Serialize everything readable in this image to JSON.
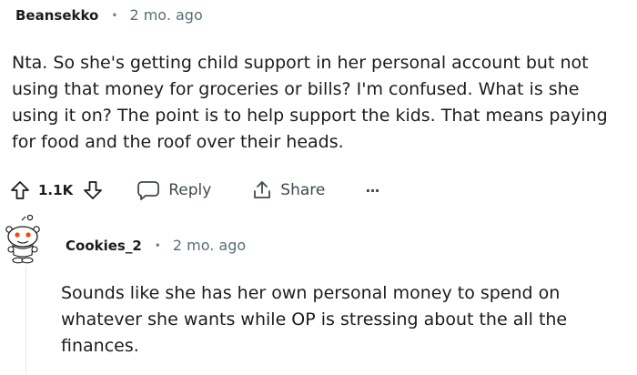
{
  "comment1": {
    "author": "Beansekko",
    "separator": "•",
    "time": "2 mo. ago",
    "lines": [
      "Nta. So she's getting child support in her personal account but not",
      "using that money for groceries or bills? I'm confused. What is she",
      "using it on? The point is to help support the kids. That means paying",
      "for food and the roof over their heads."
    ],
    "actions": {
      "vote_count": "1.1K",
      "reply_label": "Reply",
      "share_label": "Share",
      "more_label": "···",
      "icons": [
        "upvote-icon",
        "downvote-icon",
        "reply-bubble-icon",
        "share-icon"
      ]
    }
  },
  "comment2": {
    "author": "Cookies_2",
    "separator": "•",
    "time": "2 mo. ago",
    "lines": [
      "Sounds like she has her own personal money to spend on",
      "whatever she wants while OP is stressing about the all the",
      "finances."
    ],
    "avatar_icon": "snoo-avatar-icon"
  }
}
